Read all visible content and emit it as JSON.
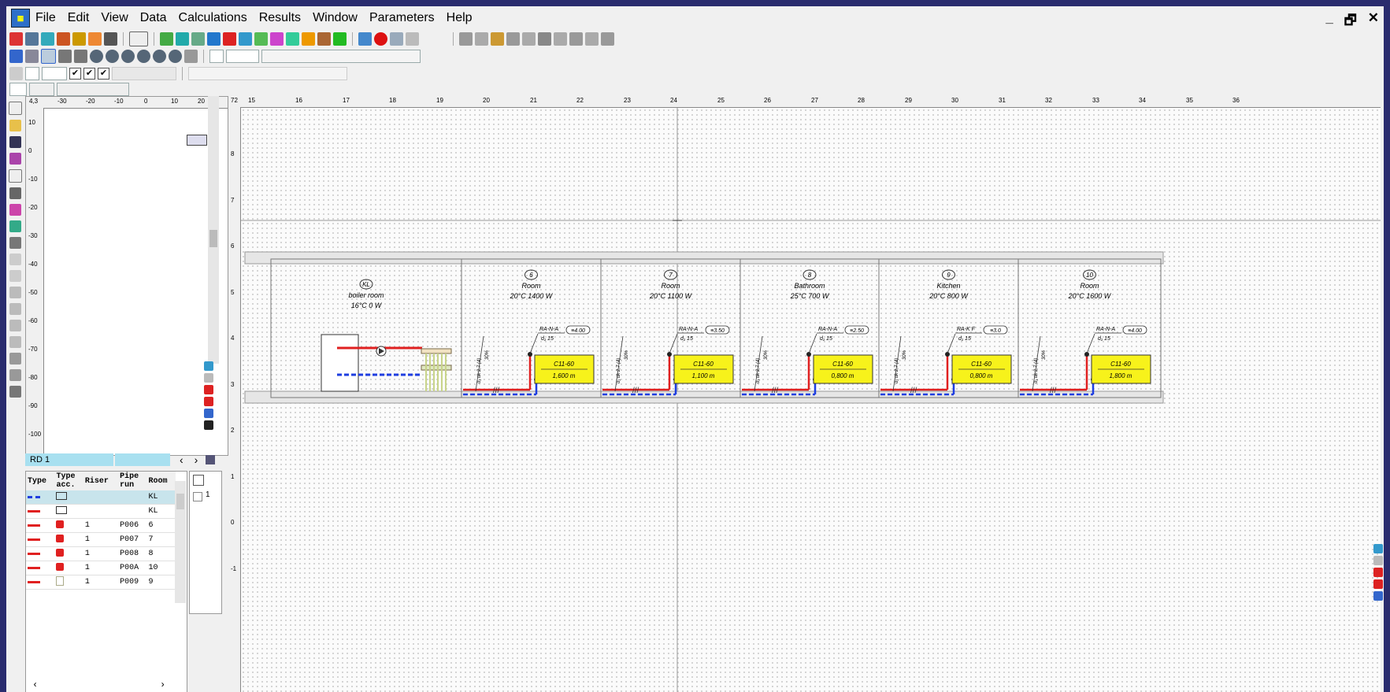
{
  "menu": [
    "File",
    "Edit",
    "View",
    "Data",
    "Calculations",
    "Results",
    "Window",
    "Parameters",
    "Help"
  ],
  "window_controls": [
    "_",
    "🗗",
    "✕"
  ],
  "overview": {
    "ruler_top": [
      "4,3",
      "-30",
      "-20",
      "-10",
      "0",
      "10",
      "20"
    ],
    "ruler_left": [
      "10",
      "0",
      "-10",
      "-20",
      "-30",
      "-40",
      "-50",
      "-60",
      "-70",
      "-80",
      "-90",
      "-100"
    ]
  },
  "sheet_tab": "RD 1",
  "grid": {
    "headers": [
      "Type",
      "Type\nacc.",
      "Riser",
      "Pipe\nrun",
      "Room"
    ],
    "rows": [
      [
        "",
        "",
        "",
        "",
        "KL"
      ],
      [
        "",
        "",
        "",
        "",
        "KL"
      ],
      [
        "",
        "",
        "1",
        "P006",
        "6"
      ],
      [
        "",
        "",
        "1",
        "P007",
        "7"
      ],
      [
        "",
        "",
        "1",
        "P008",
        "8"
      ],
      [
        "",
        "",
        "1",
        "P00A",
        "10"
      ],
      [
        "",
        "",
        "1",
        "P009",
        "9"
      ]
    ],
    "side_value": "1"
  },
  "canvas": {
    "ruler_top_start": "72",
    "ruler_top": [
      "15",
      "16",
      "17",
      "18",
      "19",
      "20",
      "21",
      "22",
      "23",
      "24",
      "25",
      "26",
      "27",
      "28",
      "29",
      "30",
      "31",
      "32",
      "33",
      "34",
      "35",
      "36"
    ],
    "ruler_left": [
      "8",
      "7",
      "6",
      "5",
      "4",
      "3",
      "2",
      "1",
      "0",
      "-1"
    ]
  },
  "rooms": [
    {
      "id": "KL",
      "name": "boiler room",
      "spec": "16°C 0 W"
    },
    {
      "id": "6",
      "name": "Room",
      "spec": "20°C 1400 W",
      "valve": "RA-N-A",
      "d": "d₁ 15",
      "setting": "≡4.00",
      "radiator": "C11-60",
      "length": "1,600 m"
    },
    {
      "id": "7",
      "name": "Room",
      "spec": "20°C 1100 W",
      "valve": "RA-N-A",
      "d": "d₁ 15",
      "setting": "≡3.50",
      "radiator": "C11-60",
      "length": "1,100 m"
    },
    {
      "id": "8",
      "name": "Bathroom",
      "spec": "25°C 700 W",
      "valve": "RA-N-A",
      "d": "d₁ 15",
      "setting": "≡2.50",
      "radiator": "C11-60",
      "length": "0,800 m"
    },
    {
      "id": "9",
      "name": "Kitchen",
      "spec": "20°C 800 W",
      "valve": "RA-K F",
      "d": "d₁ 15",
      "setting": "≡3.0",
      "radiator": "C11-60",
      "length": "0,800 m"
    },
    {
      "id": "10",
      "name": "Room",
      "spec": "20°C 1600 W",
      "valve": "RA-N-A",
      "d": "d₁ 15",
      "setting": "≡4.00",
      "radiator": "C11-60",
      "length": "1,800 m"
    }
  ],
  "riser_label": "d₁ dk 2,7 (4)",
  "riser_pct": "30%",
  "colors": {
    "supply": "#e02020",
    "return": "#1e3ee0",
    "radiator": "#f7f21b",
    "pipe_floor": "#c8d48a"
  }
}
